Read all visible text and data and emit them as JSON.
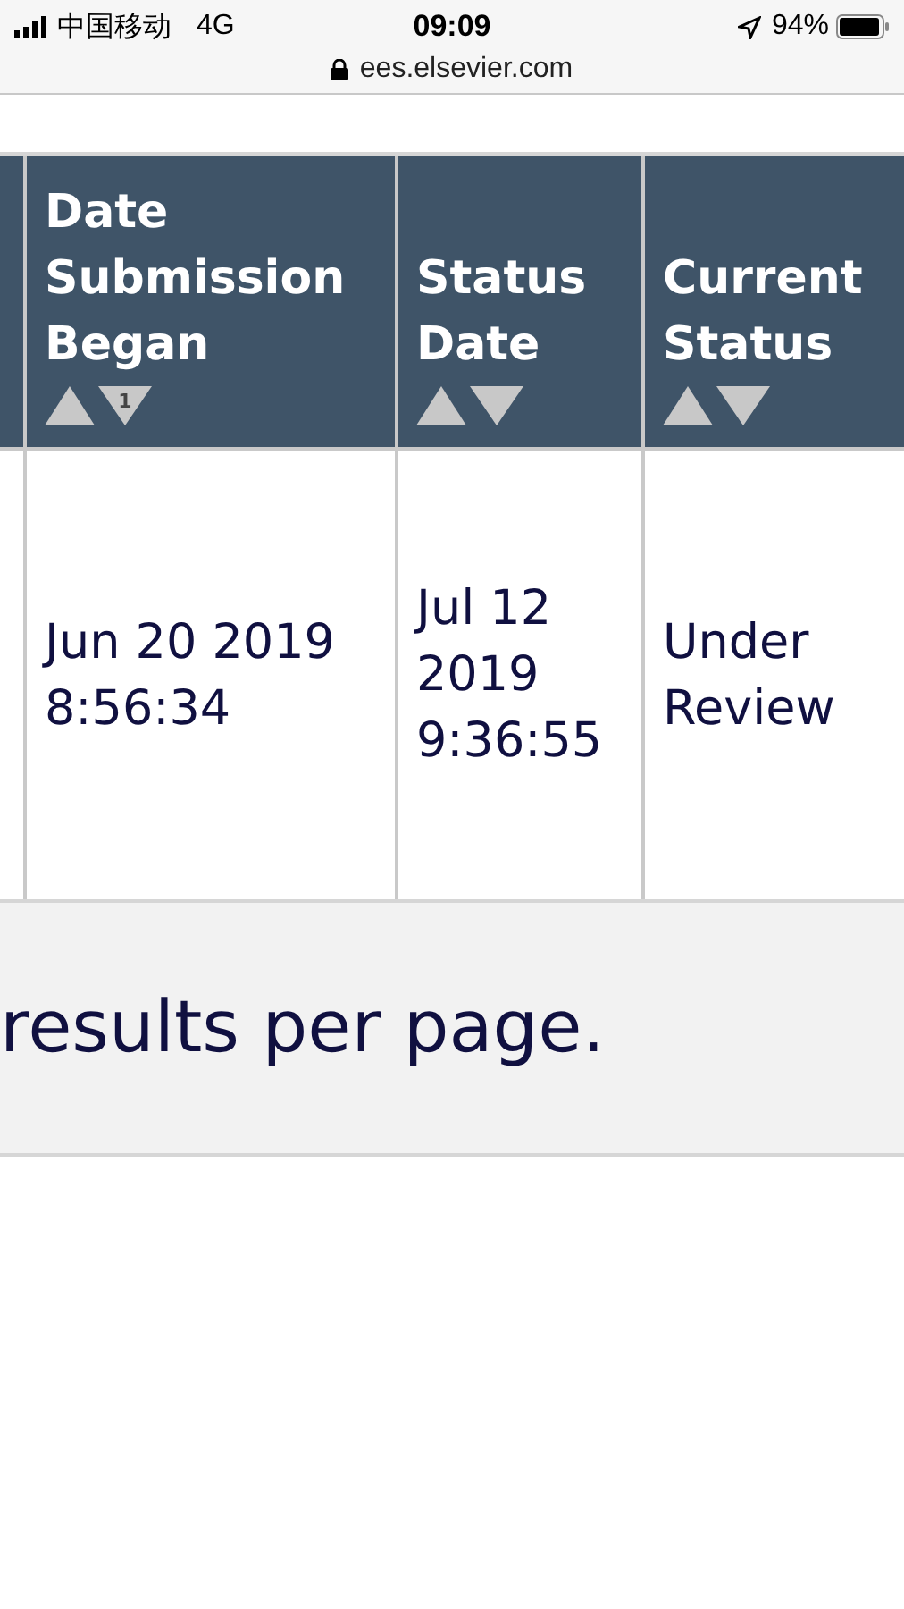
{
  "status_bar": {
    "carrier": "中国移动",
    "network": "4G",
    "time": "09:09",
    "battery": "94%"
  },
  "address_bar": {
    "url": "ees.elsevier.com"
  },
  "table": {
    "columns": [
      {},
      {
        "label": "Date Submission Began",
        "sort_rank": "1"
      },
      {
        "label": "Status Date"
      },
      {
        "label": "Current Status"
      }
    ],
    "rows": [
      [
        "",
        "Jun 20 2019 8:56:34",
        "Jul 12 2019 9:36:55",
        "Under Review"
      ]
    ]
  },
  "footer": {
    "text": "results per page."
  }
}
